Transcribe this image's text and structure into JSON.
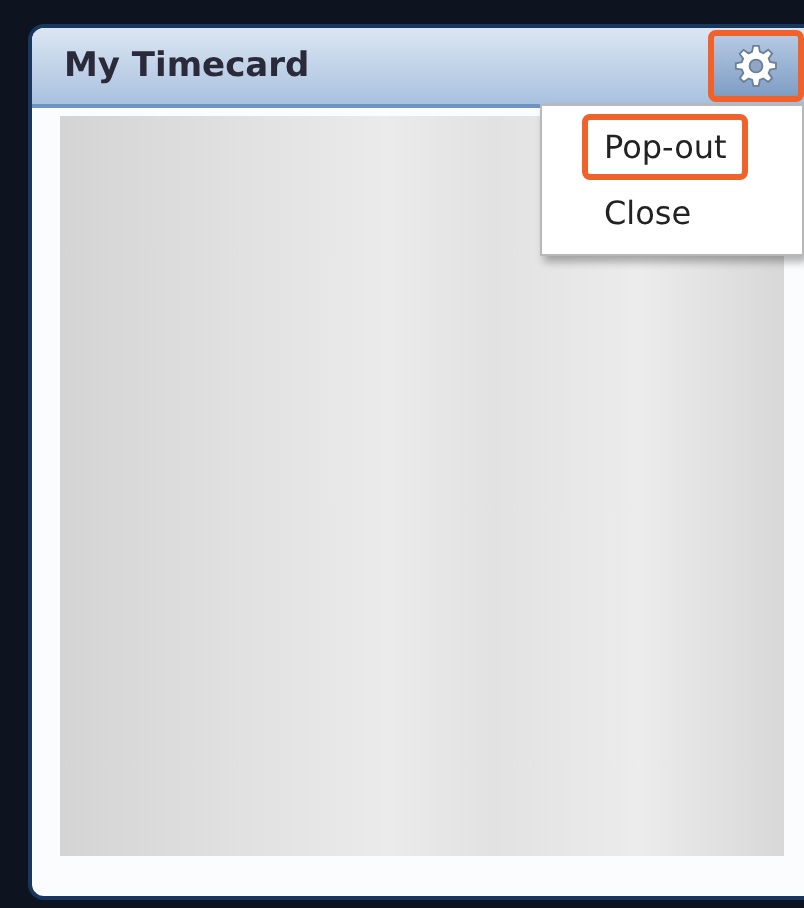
{
  "window": {
    "title": "My Timecard",
    "settings_highlighted": true
  },
  "menu": {
    "items": [
      {
        "label": "Pop-out",
        "highlighted": true
      },
      {
        "label": "Close",
        "highlighted": false
      }
    ]
  }
}
